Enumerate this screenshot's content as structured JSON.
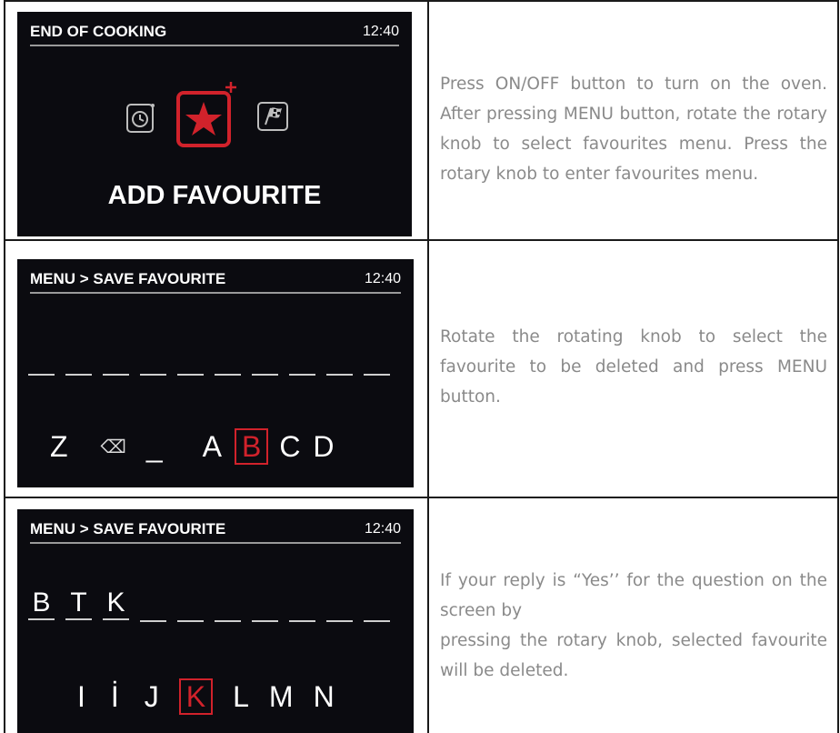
{
  "rows": [
    {
      "screen": {
        "header_title": "END OF COOKING",
        "time": "12:40",
        "label": "ADD FAVOURITE",
        "icons": [
          "timer-icon",
          "star-favourite-icon",
          "finish-flag-icon"
        ],
        "accent": "#d1222b"
      },
      "text": "Press ON/OFF button to turn on the oven. After pressing MENU button, rotate the rotary knob to select favourites menu. Press the rotary knob to enter favourites menu."
    },
    {
      "screen": {
        "header_title": "MENU > SAVE FAVOURITE",
        "time": "12:40",
        "letters": [
          "Z",
          "⌫",
          "_",
          "A",
          "B",
          "C",
          "D"
        ],
        "selected_letter": "B"
      },
      "text": "Rotate the rotating knob to select the favourite to be deleted and press MENU button."
    },
    {
      "screen": {
        "header_title": "MENU > SAVE FAVOURITE",
        "time": "12:40",
        "entered": [
          "B",
          "T",
          "K"
        ],
        "letters": [
          "I",
          "İ",
          "J",
          "K",
          "L",
          "M",
          "N"
        ],
        "selected_letter": "K"
      },
      "text_line1": "If your reply is “Yes’’ for the question on the screen by",
      "text_line2": "pressing the rotary knob, selected favourite will be deleted."
    }
  ]
}
